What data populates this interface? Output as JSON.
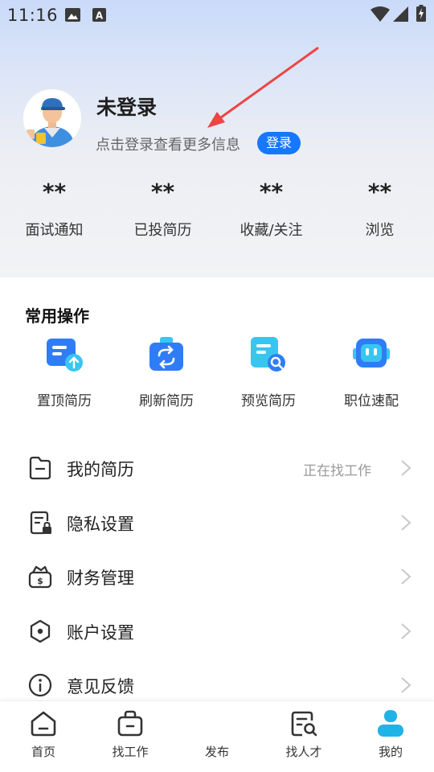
{
  "status_bar": {
    "time": "11:16",
    "icons": [
      "image-icon",
      "text-a-icon",
      "wifi-icon",
      "signal-icon",
      "battery-charging-icon"
    ]
  },
  "profile": {
    "name": "未登录",
    "hint": "点击登录查看更多信息",
    "login_button": "登录"
  },
  "stats": [
    {
      "value": "**",
      "label": "面试通知"
    },
    {
      "value": "**",
      "label": "已投简历"
    },
    {
      "value": "**",
      "label": "收藏/关注"
    },
    {
      "value": "**",
      "label": "浏览"
    }
  ],
  "quick_actions": {
    "title": "常用操作",
    "items": [
      {
        "label": "置顶简历",
        "icon": "resume-upload-icon"
      },
      {
        "label": "刷新简历",
        "icon": "refresh-bag-icon"
      },
      {
        "label": "预览简历",
        "icon": "resume-search-icon"
      },
      {
        "label": "职位速配",
        "icon": "robot-icon"
      }
    ]
  },
  "menu": [
    {
      "label": "我的简历",
      "status": "正在找工作",
      "icon": "folder-icon"
    },
    {
      "label": "隐私设置",
      "status": "",
      "icon": "privacy-lock-icon"
    },
    {
      "label": "财务管理",
      "status": "",
      "icon": "wallet-icon"
    },
    {
      "label": "账户设置",
      "status": "",
      "icon": "hexagon-settings-icon"
    },
    {
      "label": "意见反馈",
      "status": "",
      "icon": "info-icon"
    }
  ],
  "tabbar": [
    {
      "label": "首页",
      "icon": "home-icon",
      "active": false
    },
    {
      "label": "找工作",
      "icon": "briefcase-icon",
      "active": false
    },
    {
      "label": "发布",
      "icon": "",
      "active": false
    },
    {
      "label": "找人才",
      "icon": "search-doc-icon",
      "active": false
    },
    {
      "label": "我的",
      "icon": "user-icon",
      "active": true
    }
  ],
  "colors": {
    "accent": "#1677ff",
    "active_tab": "#1fb4e6",
    "annotation_arrow": "#ee4444"
  }
}
